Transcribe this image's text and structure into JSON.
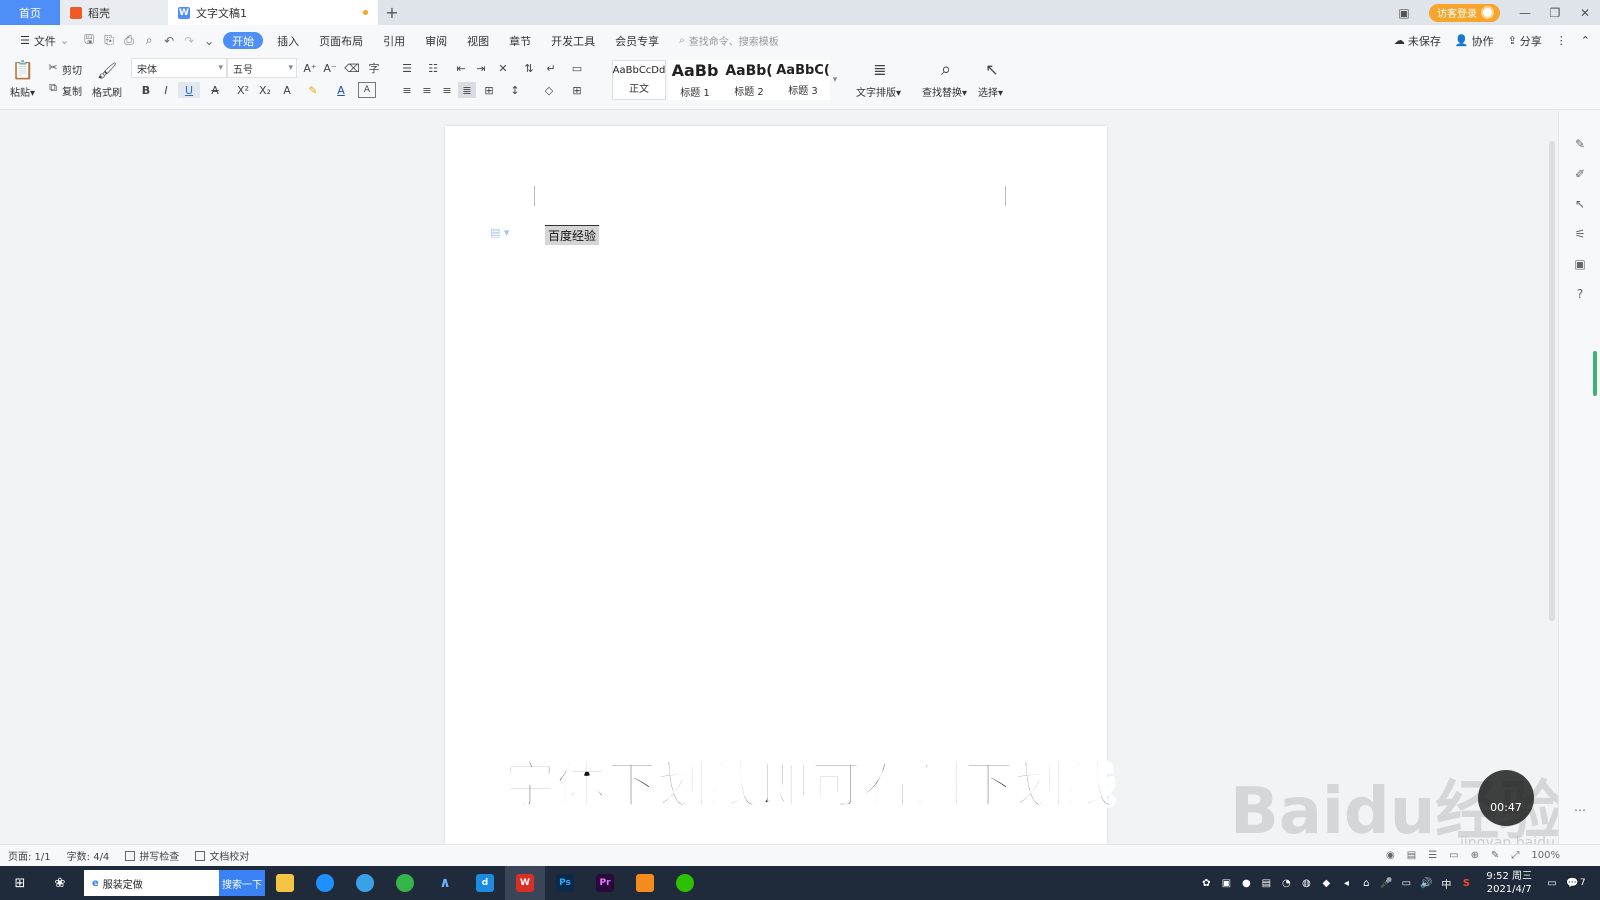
{
  "tabs": {
    "home": "首页",
    "daoke": "稻壳",
    "doc": "文字文稿1",
    "login": "访客登录"
  },
  "menu": {
    "file": "文件",
    "items": [
      "开始",
      "插入",
      "页面布局",
      "引用",
      "审阅",
      "视图",
      "章节",
      "开发工具",
      "会员专享"
    ],
    "search_placeholder": "查找命令、搜索模板",
    "unsaved": "未保存",
    "collab": "协作",
    "share": "分享"
  },
  "ribbon": {
    "paste": "粘贴",
    "cut": "剪切",
    "copy": "复制",
    "format_painter": "格式刷",
    "font_family": "宋体",
    "font_size": "五号",
    "styles": [
      {
        "preview": "AaBbCcDd",
        "name": "正文"
      },
      {
        "preview": "AaBb",
        "name": "标题 1"
      },
      {
        "preview": "AaBb(",
        "name": "标题 2"
      },
      {
        "preview": "AaBbC(",
        "name": "标题 3"
      }
    ],
    "text_layout": "文字排版",
    "find_replace": "查找替换",
    "select": "选择"
  },
  "document": {
    "text": "百度经验"
  },
  "overlay": {
    "subtitle": "字体下划线即可看到下划线",
    "watermark": "Baidu经验",
    "watermark_sub": "jingyan.baidu.com",
    "timer": "00:47"
  },
  "status": {
    "page": "页面: 1/1",
    "words": "字数: 4/4",
    "spell": "拼写检查",
    "proof": "文档校对",
    "zoom": "100%"
  },
  "taskbar": {
    "search_value": "服装定做",
    "search_button": "搜索一下",
    "ime": "中",
    "time": "9:52 周三",
    "date": "2021/4/7",
    "notification_count": "7"
  }
}
